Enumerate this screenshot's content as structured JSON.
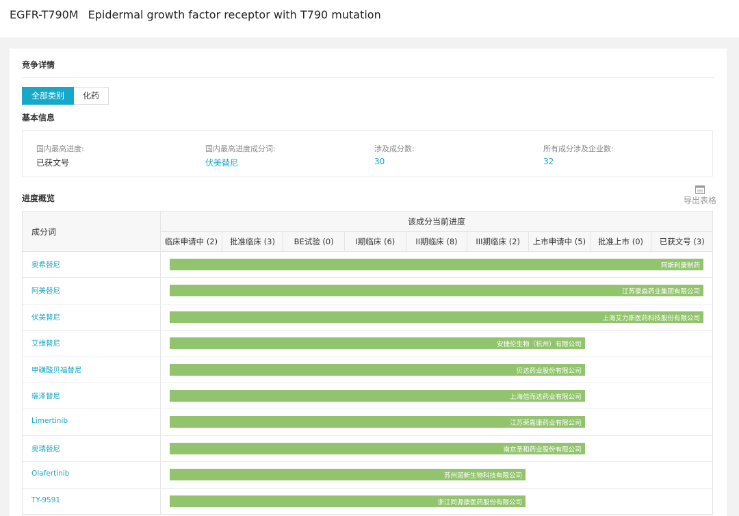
{
  "header": {
    "code": "EGFR-T790M",
    "name": "Epidermal growth factor receptor with T790 mutation"
  },
  "competition": {
    "title": "竞争详情",
    "tabs": [
      {
        "label": "全部类别",
        "active": true
      },
      {
        "label": "化药",
        "active": false
      }
    ]
  },
  "basic_info": {
    "title": "基本信息",
    "items": [
      {
        "label": "国内最高进度:",
        "value": "已获文号",
        "link": false
      },
      {
        "label": "国内最高进度成分词:",
        "value": "伏美替尼",
        "link": true
      },
      {
        "label": "涉及成分数:",
        "value": "30",
        "link": true
      },
      {
        "label": "所有成分涉及企业数:",
        "value": "32",
        "link": true
      }
    ]
  },
  "progress": {
    "title": "进度概览",
    "export_label": "导出表格",
    "col_name_header": "成分词",
    "group_header": "该成分当前进度",
    "stages": [
      "临床申请中 (2)",
      "批准临床 (3)",
      "BE试验 (0)",
      "I期临床 (6)",
      "II期临床 (8)",
      "III期临床 (2)",
      "上市申请中 (5)",
      "批准上市 (0)",
      "已获文号 (3)"
    ],
    "bar_color": "#92c46e",
    "rows": [
      {
        "name": "奥希替尼",
        "company": "阿斯利康制药",
        "stage_reached": 9
      },
      {
        "name": "阿美替尼",
        "company": "江苏豪森药业集团有限公司",
        "stage_reached": 9
      },
      {
        "name": "伏美替尼",
        "company": "上海艾力斯医药科技股份有限公司",
        "stage_reached": 9
      },
      {
        "name": "艾维替尼",
        "company": "安捷伦生物（杭州）有限公司",
        "stage_reached": 7
      },
      {
        "name": "甲磺酸贝福替尼",
        "company": "贝达药业股份有限公司",
        "stage_reached": 7
      },
      {
        "name": "瑞泽替尼",
        "company": "上海倍而达药业有限公司",
        "stage_reached": 7
      },
      {
        "name": "Limertinib",
        "company": "江苏荣嘉康药业有限公司",
        "stage_reached": 7
      },
      {
        "name": "奥瑞替尼",
        "company": "南京圣和药业股份有限公司",
        "stage_reached": 7
      },
      {
        "name": "Olafertinib",
        "company": "苏州润新生物科技有限公司",
        "stage_reached": 6
      },
      {
        "name": "TY-9591",
        "company": "浙江同源康医药股份有限公司",
        "stage_reached": 6
      }
    ]
  },
  "accent_color": "#16a8c8"
}
